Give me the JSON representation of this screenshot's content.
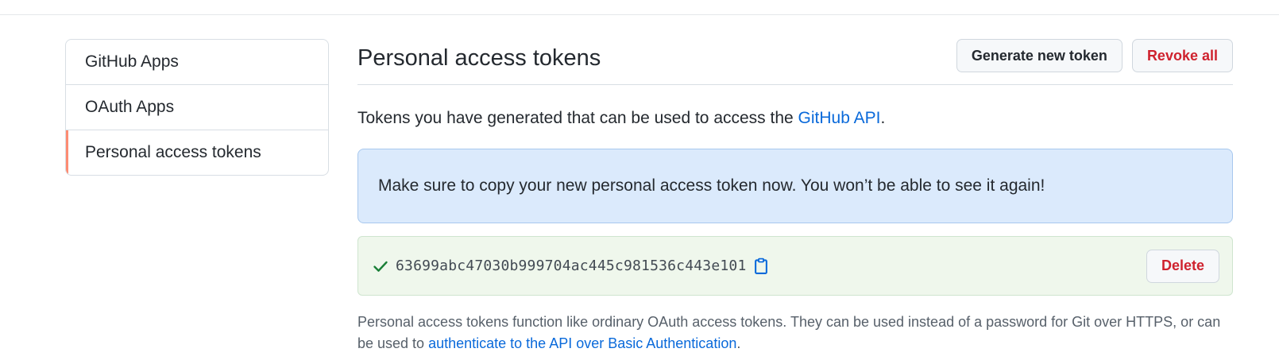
{
  "sidebar": {
    "items": [
      {
        "label": "GitHub Apps"
      },
      {
        "label": "OAuth Apps"
      },
      {
        "label": "Personal access tokens"
      }
    ]
  },
  "header": {
    "title": "Personal access tokens",
    "generate_label": "Generate new token",
    "revoke_label": "Revoke all"
  },
  "intro": {
    "text": "Tokens you have generated that can be used to access the ",
    "link": "GitHub API",
    "suffix": "."
  },
  "flash": {
    "message": "Make sure to copy your new personal access token now. You won’t be able to see it again!"
  },
  "token": {
    "value": "63699abc47030b999704ac445c981536c443e101",
    "delete_label": "Delete"
  },
  "footnote": {
    "text": "Personal access tokens function like ordinary OAuth access tokens. They can be used instead of a password for Git over HTTPS, or can be used to ",
    "link": "authenticate to the API over Basic Authentication",
    "suffix": "."
  },
  "icons": {
    "check": "check-icon",
    "copy": "clipboard-icon"
  },
  "colors": {
    "accent_nav": "#fd8c73",
    "link": "#0969da",
    "danger": "#cf222e",
    "success": "#1a7f37",
    "flash_bg": "#dbeafc",
    "token_bg": "#eff7ec"
  }
}
